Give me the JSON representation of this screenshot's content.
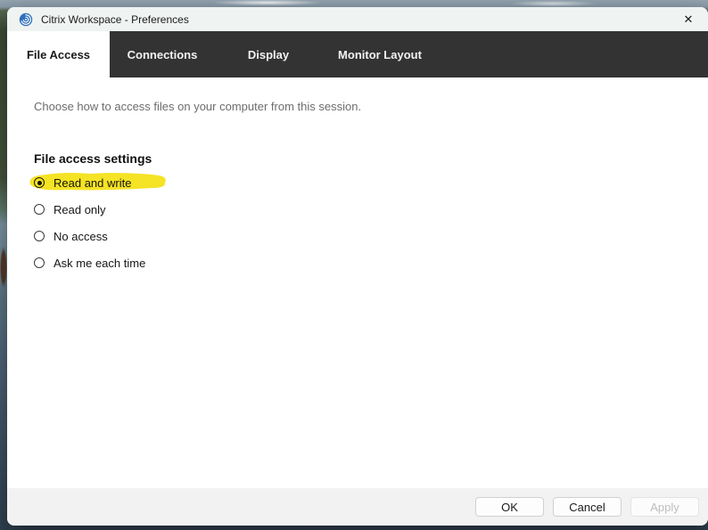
{
  "window": {
    "title": "Citrix Workspace - Preferences"
  },
  "icons": {
    "app_icon": "citrix-workspace-logo",
    "close_glyph": "✕"
  },
  "tabs": [
    {
      "label": "File Access",
      "active": true
    },
    {
      "label": "Connections",
      "active": false
    },
    {
      "label": "Display",
      "active": false
    },
    {
      "label": "Monitor Layout",
      "active": false
    }
  ],
  "content": {
    "description": "Choose how to access files on your computer from this session.",
    "group_label": "File access settings",
    "options": [
      {
        "label": "Read and write",
        "selected": true,
        "highlighted": true
      },
      {
        "label": "Read only",
        "selected": false,
        "highlighted": false
      },
      {
        "label": "No access",
        "selected": false,
        "highlighted": false
      },
      {
        "label": "Ask me each time",
        "selected": false,
        "highlighted": false
      }
    ]
  },
  "footer": {
    "buttons": [
      {
        "label": "OK",
        "enabled": true
      },
      {
        "label": "Cancel",
        "enabled": true
      },
      {
        "label": "Apply",
        "enabled": false
      }
    ]
  },
  "colors": {
    "tab_bar": "#333333",
    "title_bar": "#eff3f1",
    "footer_bar": "#f2f2f2",
    "highlight_marker": "#f4e112",
    "citrix_blue": "#2f6fbe"
  }
}
